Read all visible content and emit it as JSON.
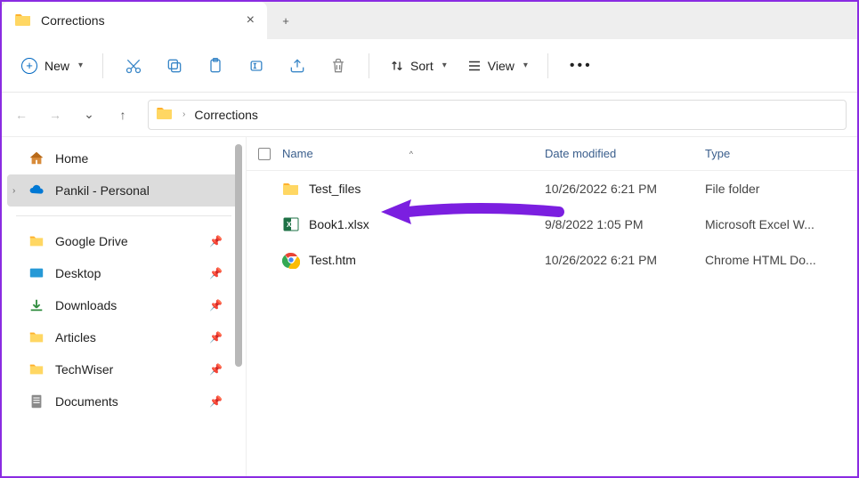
{
  "tabs": {
    "active": {
      "title": "Corrections"
    },
    "newtab_glyph": "+"
  },
  "toolbar": {
    "new_label": "New",
    "sort_label": "Sort",
    "view_label": "View"
  },
  "breadcrumb": {
    "segments": [
      "Corrections"
    ]
  },
  "sidebar": {
    "home": "Home",
    "onedrive": "Pankil - Personal",
    "quick": [
      {
        "label": "Google Drive"
      },
      {
        "label": "Desktop"
      },
      {
        "label": "Downloads"
      },
      {
        "label": "Articles"
      },
      {
        "label": "TechWiser"
      },
      {
        "label": "Documents"
      }
    ]
  },
  "columns": {
    "name": "Name",
    "date": "Date modified",
    "type": "Type"
  },
  "files": [
    {
      "name": "Test_files",
      "date": "10/26/2022 6:21 PM",
      "type": "File folder",
      "icon": "folder"
    },
    {
      "name": "Book1.xlsx",
      "date": "9/8/2022 1:05 PM",
      "type": "Microsoft Excel W...",
      "icon": "excel"
    },
    {
      "name": "Test.htm",
      "date": "10/26/2022 6:21 PM",
      "type": "Chrome HTML Do...",
      "icon": "chrome"
    }
  ]
}
